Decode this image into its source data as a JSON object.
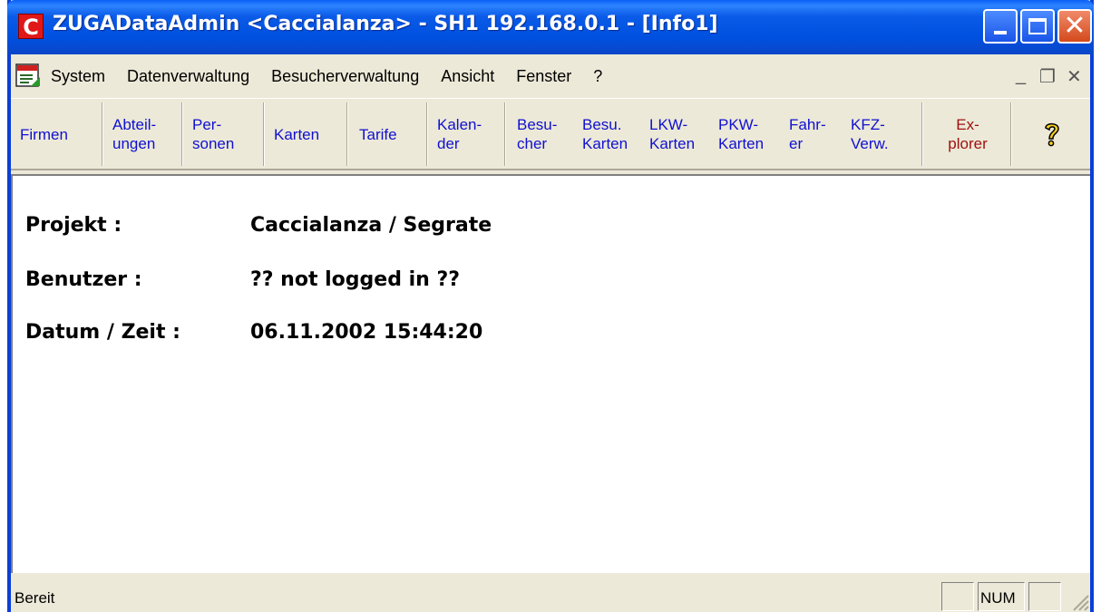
{
  "window": {
    "title": "ZUGADataAdmin <Caccialanza> - SH1 192.168.0.1 - [Info1]",
    "app_icon_letter": "C"
  },
  "menu": [
    "System",
    "Datenverwaltung",
    "Besucherverwaltung",
    "Ansicht",
    "Fenster",
    "?"
  ],
  "toolbar": [
    {
      "line1": "Firmen",
      "line2": ""
    },
    {
      "line1": "Abteil-",
      "line2": "ungen"
    },
    {
      "line1": "Per-",
      "line2": "sonen"
    },
    {
      "line1": "Karten",
      "line2": ""
    },
    {
      "line1": "Tarife",
      "line2": ""
    },
    {
      "line1": "Kalen-",
      "line2": "der"
    },
    {
      "line1": "Besu-",
      "line2": "cher"
    },
    {
      "line1": "Besu.",
      "line2": "Karten"
    },
    {
      "line1": "LKW-",
      "line2": "Karten"
    },
    {
      "line1": "PKW-",
      "line2": "Karten"
    },
    {
      "line1": "Fahr-",
      "line2": "er"
    },
    {
      "line1": "KFZ-",
      "line2": "Verw."
    },
    {
      "line1": "Ex-",
      "line2": "plorer"
    }
  ],
  "info": {
    "projekt_label": "Projekt :",
    "projekt_value": "Caccialanza / Segrate",
    "benutzer_label": "Benutzer :",
    "benutzer_value": "?? not logged in ??",
    "datum_label": "Datum / Zeit :",
    "datum_value": "06.11.2002 15:44:20"
  },
  "status": {
    "text": "Bereit",
    "num": "NUM"
  },
  "colors": {
    "titlebar": "#0A5EF5",
    "toolbar_text": "#1010D0",
    "explorer_text": "#A01010",
    "close_button": "#D44A1C"
  }
}
